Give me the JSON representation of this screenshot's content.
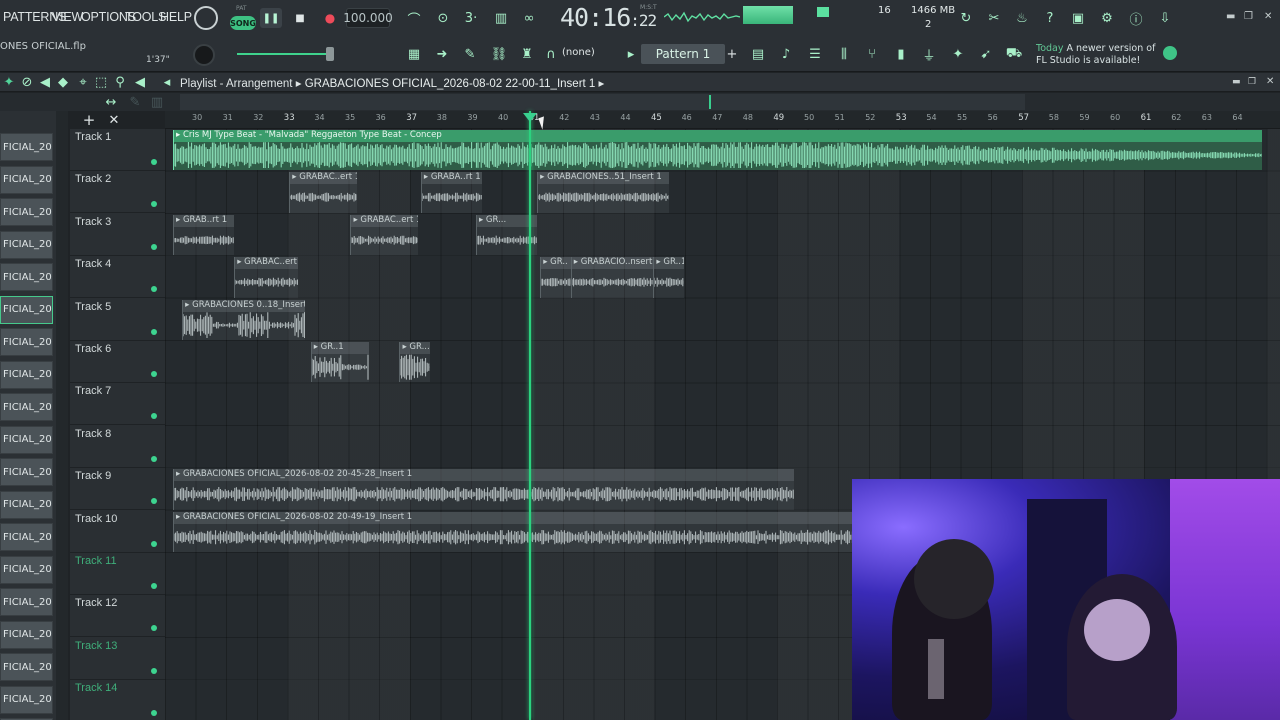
{
  "menu": [
    "PATTERNS",
    "VIEW",
    "OPTIONS",
    "TOOLS",
    "HELP"
  ],
  "transport": {
    "pat_label": "PAT",
    "song_label": "SONG",
    "play": "❚❚",
    "stop": "■",
    "record": "●",
    "tempo": "100.000"
  },
  "time": {
    "main": "40:16",
    "sub": ":22",
    "mst": "M:S:T"
  },
  "monitor": {
    "cpu": "16",
    "memory": "1466 MB",
    "polyphony": "2"
  },
  "file_name": "ONES OFICIAL.flp",
  "position_readout": "1'37\"",
  "snap": "(none)",
  "pattern": "Pattern 1",
  "hint": {
    "today": "Today",
    "text": "A newer version of FL Studio is available!"
  },
  "playlist": {
    "title": "Playlist - Arrangement",
    "name": "GRABACIONES OFICIAL_2026-08-02 22-00-11_Insert 1",
    "arrow": "▸"
  },
  "ruler_ticks": [
    "30",
    "31",
    "32",
    "33",
    "34",
    "35",
    "36",
    "37",
    "38",
    "39",
    "40",
    "41",
    "42",
    "43",
    "44",
    "45",
    "46",
    "47",
    "48",
    "49",
    "50",
    "51",
    "52",
    "53",
    "54",
    "55",
    "56",
    "57",
    "58",
    "59",
    "60",
    "61",
    "62",
    "63",
    "64"
  ],
  "channels": [
    "FICIAL_20...",
    "FICIAL_20...",
    "FICIAL_20...",
    "FICIAL_20...",
    "FICIAL_20...",
    "FICIAL_20...",
    "FICIAL_20...",
    "FICIAL_20...",
    "FICIAL_20...",
    "FICIAL_20...",
    "FICIAL_20...",
    "FICIAL_20...",
    "FICIAL_20...",
    "FICIAL_20...",
    "FICIAL_20...",
    "FICIAL_20...",
    "FICIAL_20...",
    "FICIAL_20...",
    "FICIAL_20..."
  ],
  "tracks": [
    {
      "name": "Track 1",
      "muted": false
    },
    {
      "name": "Track 2",
      "muted": false
    },
    {
      "name": "Track 3",
      "muted": false
    },
    {
      "name": "Track 4",
      "muted": false
    },
    {
      "name": "Track 5",
      "muted": false
    },
    {
      "name": "Track 6",
      "muted": false
    },
    {
      "name": "Track 7",
      "muted": false
    },
    {
      "name": "Track 8",
      "muted": false
    },
    {
      "name": "Track 9",
      "muted": false
    },
    {
      "name": "Track 10",
      "muted": false
    },
    {
      "name": "Track 11",
      "muted": true
    },
    {
      "name": "Track 12",
      "muted": false
    },
    {
      "name": "Track 13",
      "muted": true
    },
    {
      "name": "Track 14",
      "muted": true
    }
  ],
  "clips": [
    {
      "label": "Cris MJ Type Beat - \"Malvada\" Reggaeton Type Beat - Concep",
      "track": 0,
      "start": 0.0,
      "length": 35.6,
      "green": true,
      "wave": "dense"
    },
    {
      "label": "GRABAC..ert 1",
      "track": 1,
      "start": 3.8,
      "length": 2.2,
      "wave": "thin"
    },
    {
      "label": "GRABA..rt 1",
      "track": 1,
      "start": 8.1,
      "length": 2.0,
      "wave": "thin"
    },
    {
      "label": "GRABACIONES..51_Insert 1",
      "track": 1,
      "start": 11.9,
      "length": 4.3,
      "wave": "thin"
    },
    {
      "label": "GRAB..rt 1",
      "track": 2,
      "start": 0.0,
      "length": 2.0,
      "wave": "thin"
    },
    {
      "label": "GRABAC..ert 1",
      "track": 2,
      "start": 5.8,
      "length": 2.2,
      "wave": "thin"
    },
    {
      "label": "GR...",
      "track": 2,
      "start": 9.9,
      "length": 2.0,
      "wave": "thin"
    },
    {
      "label": "GRABAC..ert 1",
      "track": 3,
      "start": 2.0,
      "length": 2.1,
      "wave": "thin"
    },
    {
      "label": "GR..",
      "track": 3,
      "start": 12.0,
      "length": 1.0,
      "wave": "thin"
    },
    {
      "label": "GRABACIO..nsert 1",
      "track": 3,
      "start": 13.0,
      "length": 2.7,
      "wave": "thin"
    },
    {
      "label": "GR..1",
      "track": 3,
      "start": 15.7,
      "length": 1.0,
      "wave": "thin"
    },
    {
      "label": "GRABACIONES 0..18_Insert 1",
      "track": 4,
      "start": 0.3,
      "length": 4.0,
      "wave": "vocal"
    },
    {
      "label": "GR..1",
      "track": 5,
      "start": 4.5,
      "length": 1.9,
      "wave": "vocal"
    },
    {
      "label": "GR...",
      "track": 5,
      "start": 7.4,
      "length": 1.0,
      "wave": "vocal"
    },
    {
      "label": "GRABACIONES OFICIAL_2026-08-02 20-45-28_Insert 1",
      "track": 8,
      "start": 0.0,
      "length": 20.3,
      "wave": "mid"
    },
    {
      "label": "GRABACIONES OFICIAL_2026-08-02 20-49-19_Insert 1",
      "track": 9,
      "start": 0.0,
      "length": 36.0,
      "wave": "mid"
    }
  ],
  "colors": {
    "accent": "#3dd490",
    "clip_green": "#3a9c6b",
    "playhead": "#2bd27f"
  }
}
